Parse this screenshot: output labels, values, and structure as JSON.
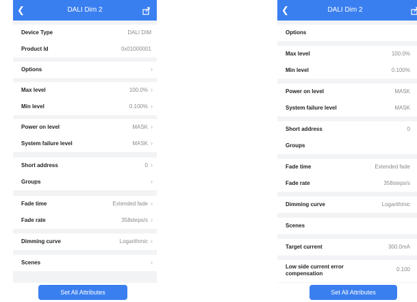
{
  "left": {
    "title": "DALI Dim 2",
    "rows": [
      {
        "label": "Device Type",
        "value": "DALI DIM"
      },
      {
        "label": "Product Id",
        "value": "0x01000001"
      },
      {
        "label": "Options",
        "value": ""
      },
      {
        "label": "Max level",
        "value": "100.0%"
      },
      {
        "label": "Min level",
        "value": "0.100%"
      },
      {
        "label": "Power on level",
        "value": "MASK"
      },
      {
        "label": "System failure level",
        "value": "MASK"
      },
      {
        "label": "Short address",
        "value": "0"
      },
      {
        "label": "Groups",
        "value": ""
      },
      {
        "label": "Fade time",
        "value": "Extended fade"
      },
      {
        "label": "Fade rate",
        "value": "358steps/s"
      },
      {
        "label": "Dimming curve",
        "value": "Logarithmic"
      },
      {
        "label": "Scenes",
        "value": ""
      }
    ],
    "button_label": "Set All Attributes"
  },
  "right": {
    "title": "DALI Dim 2",
    "rows": [
      {
        "label": "Options",
        "value": ""
      },
      {
        "label": "Max level",
        "value": "100.0%"
      },
      {
        "label": "Min level",
        "value": "0.100%"
      },
      {
        "label": "Power on level",
        "value": "MASK"
      },
      {
        "label": "System failure level",
        "value": "MASK"
      },
      {
        "label": "Short address",
        "value": "0"
      },
      {
        "label": "Groups",
        "value": ""
      },
      {
        "label": "Fade time",
        "value": "Extended fade"
      },
      {
        "label": "Fade rate",
        "value": "358steps/s"
      },
      {
        "label": "Dimming curve",
        "value": "Logarithmic"
      },
      {
        "label": "Scenes",
        "value": ""
      },
      {
        "label": "Target current",
        "value": "300.0mA"
      },
      {
        "label": "Low side current error compensation",
        "value": "0.100"
      }
    ],
    "button_label": "Set All Attributes"
  },
  "icons": {
    "back": "back-chevron-icon",
    "action": "share-icon",
    "chevron": "chevron-right-icon"
  },
  "colors": {
    "accent": "#3a7ff0",
    "background": "#f2f3f5"
  }
}
